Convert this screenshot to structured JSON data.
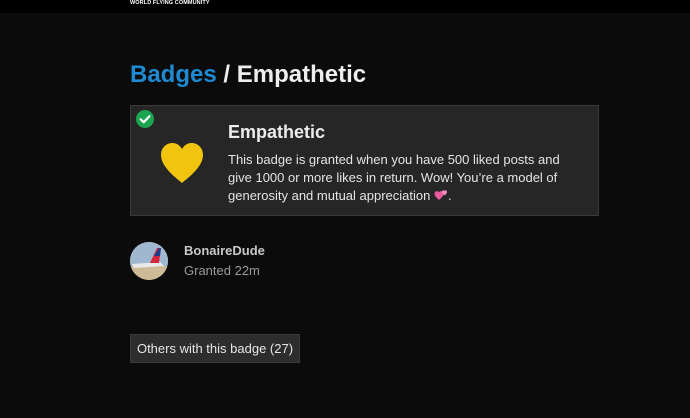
{
  "header": {
    "site_name": "WORLD FLYING COMMUNITY"
  },
  "breadcrumb": {
    "parent": "Badges",
    "separator": "/",
    "current": "Empathetic"
  },
  "badge": {
    "name": "Empathetic",
    "description": "This badge is granted when you have 500 liked posts and give 1000 or more likes in return. Wow! You’re a model of generosity and mutual appreciation",
    "description_end": ".",
    "icon": "heart-icon",
    "icon_color": "#f1c40f",
    "granted_icon": "check-circle-icon",
    "granted_color": "#1ca551"
  },
  "grant": {
    "username": "BonaireDude",
    "granted_text": "Granted 22m"
  },
  "others_button": {
    "label": "Others with this badge (27)"
  },
  "colors": {
    "background": "#0b0b0b",
    "card": "#262626",
    "link": "#1e8ad2"
  }
}
